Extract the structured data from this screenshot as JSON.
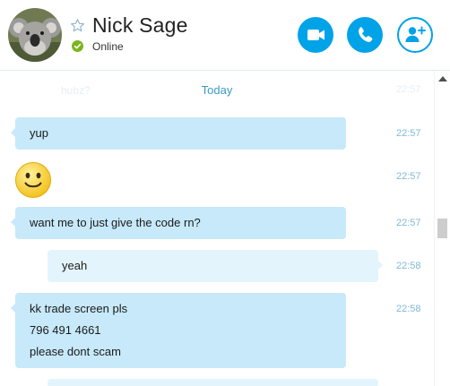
{
  "contact": {
    "name": "Nick Sage",
    "status": "Online"
  },
  "header_buttons": {
    "video_call": "video-call",
    "audio_call": "audio-call",
    "add_people": "add-people"
  },
  "colors": {
    "accent": "#00a2e8",
    "incoming_bubble": "#c7e9fa",
    "outgoing_bubble": "#e3f4fc",
    "online": "#7ab51d",
    "date_divider": "#3a9bc7",
    "timestamp": "#7fb9d5"
  },
  "chat": {
    "faded_previous_text": "hubz?",
    "faded_previous_time": "22:57",
    "date_divider": "Today",
    "messages": [
      {
        "direction": "in",
        "lines": [
          "yup"
        ],
        "time": "22:57"
      },
      {
        "direction": "in",
        "emoticon": "smile-emoticon",
        "time": "22:57"
      },
      {
        "direction": "in",
        "lines": [
          "want me to just give the code rn?"
        ],
        "time": "22:57"
      },
      {
        "direction": "out",
        "lines": [
          "yeah"
        ],
        "time": "22:58"
      },
      {
        "direction": "in",
        "lines": [
          "kk trade screen pls",
          "796 491 4661",
          "please dont scam"
        ],
        "time": "22:58"
      }
    ]
  }
}
